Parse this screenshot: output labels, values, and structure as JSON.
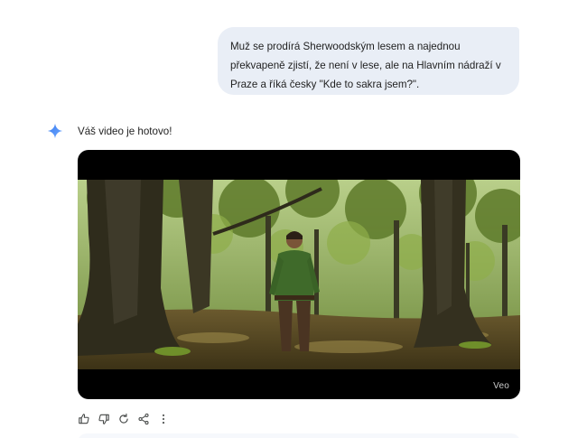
{
  "conversation": {
    "user_prompt": "Muž se prodírá Sherwoodským lesem a najednou překvapeně zjistí, že není v lese, ale na Hlavním nádraží v Praze a říká česky \"Kde to sakra jsem?\".",
    "model_reply": {
      "icon": "sparkle-icon",
      "text": "Váš video je hotovo!",
      "video": {
        "watermark": "Veo"
      },
      "actions": [
        {
          "name": "thumb-up-icon"
        },
        {
          "name": "thumb-down-icon"
        },
        {
          "name": "redo-icon"
        },
        {
          "name": "share-icon"
        },
        {
          "name": "more-vert-icon"
        }
      ]
    }
  },
  "colors": {
    "user_bubble_bg": "#e9eef6",
    "accent_blue": "#4b8ef5",
    "icon_gray": "#444746"
  }
}
